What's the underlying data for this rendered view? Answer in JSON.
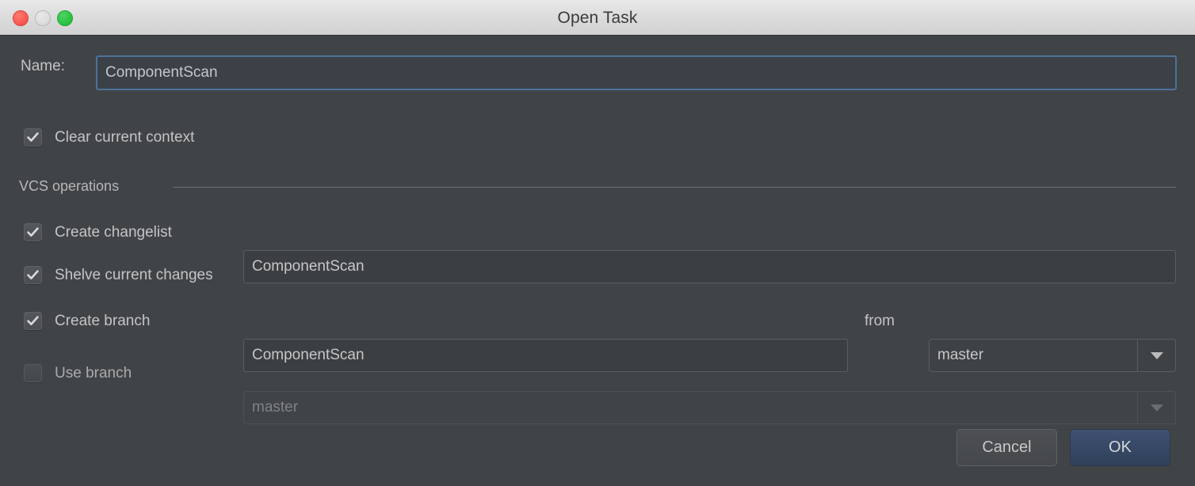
{
  "window": {
    "title": "Open Task",
    "traffic_lights": [
      "close",
      "minimize",
      "zoom"
    ]
  },
  "form": {
    "name_label": "Name:",
    "name_value": "ComponentScan",
    "clear_context_label": "Clear current context",
    "clear_context_checked": true,
    "group_label": "VCS operations",
    "create_changelist_label": "Create changelist",
    "create_changelist_checked": true,
    "create_changelist_value": "ComponentScan",
    "shelve_changes_label": "Shelve current changes",
    "shelve_changes_checked": true,
    "create_branch_label": "Create branch",
    "create_branch_checked": true,
    "create_branch_value": "ComponentScan",
    "from_label": "from",
    "from_branch_value": "master",
    "use_branch_label": "Use branch",
    "use_branch_checked": false,
    "use_branch_value": "master"
  },
  "buttons": {
    "cancel_label": "Cancel",
    "ok_label": "OK"
  },
  "colors": {
    "background": "#414447",
    "text": "#c2c4c6",
    "focus_border": "#4d7299",
    "primary_button": "#3e5170",
    "titlebar": "#dcdcdc",
    "close_light": "#f9564d",
    "minimize_light": "#dcdcdc",
    "zoom_light": "#27c13f"
  }
}
